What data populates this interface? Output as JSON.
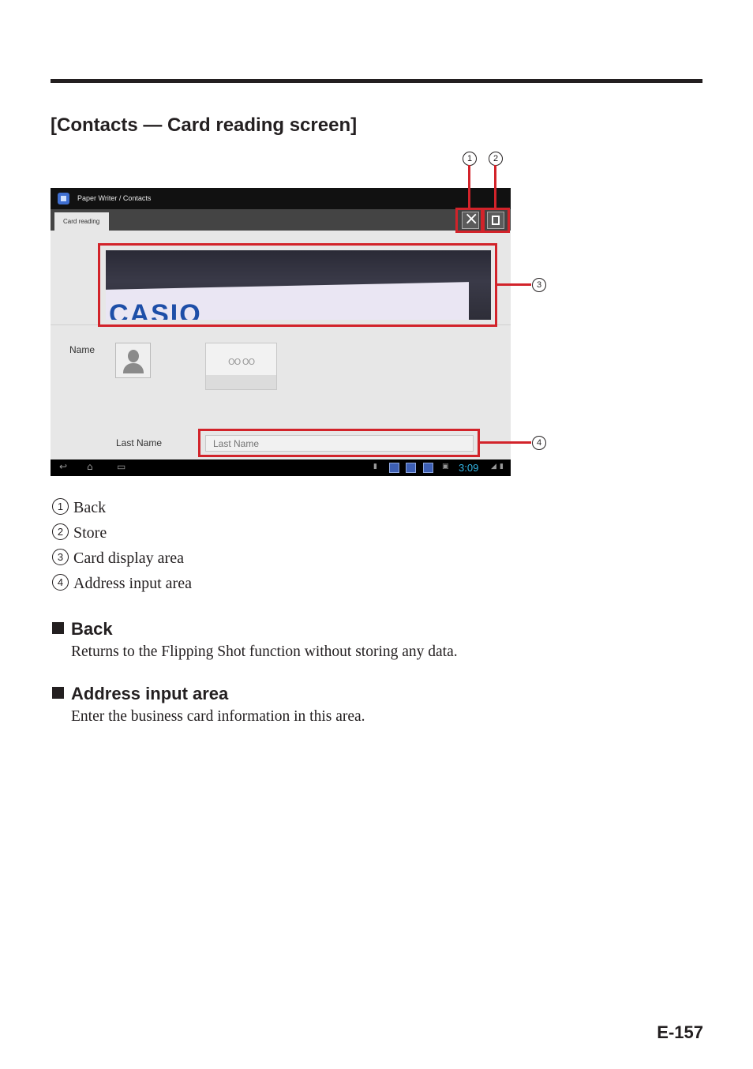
{
  "section": {
    "title": "[Contacts — Card reading screen]"
  },
  "callouts": [
    "1",
    "2",
    "3",
    "4"
  ],
  "screen": {
    "app_title": "Paper Writer / Contacts",
    "tab_label": "Card reading",
    "card_text": "CASIO",
    "name_label": "Name",
    "last_name_label": "Last Name",
    "last_name_placeholder": "Last Name",
    "thumb_text": "OO OO",
    "clock": "3:09",
    "icons": {
      "back": "close-icon",
      "store": "store-icon"
    }
  },
  "legend": [
    {
      "num": "1",
      "text": "Back"
    },
    {
      "num": "2",
      "text": "Store"
    },
    {
      "num": "3",
      "text": "Card display area"
    },
    {
      "num": "4",
      "text": "Address input area"
    }
  ],
  "sections": [
    {
      "heading": "Back",
      "body": "Returns to the Flipping Shot function without storing any data."
    },
    {
      "heading": "Address input area",
      "body": "Enter the business card information in this area."
    }
  ],
  "page_number": "E-157",
  "colors": {
    "callout_red": "#d2232a",
    "clock_blue": "#33b5e5"
  }
}
